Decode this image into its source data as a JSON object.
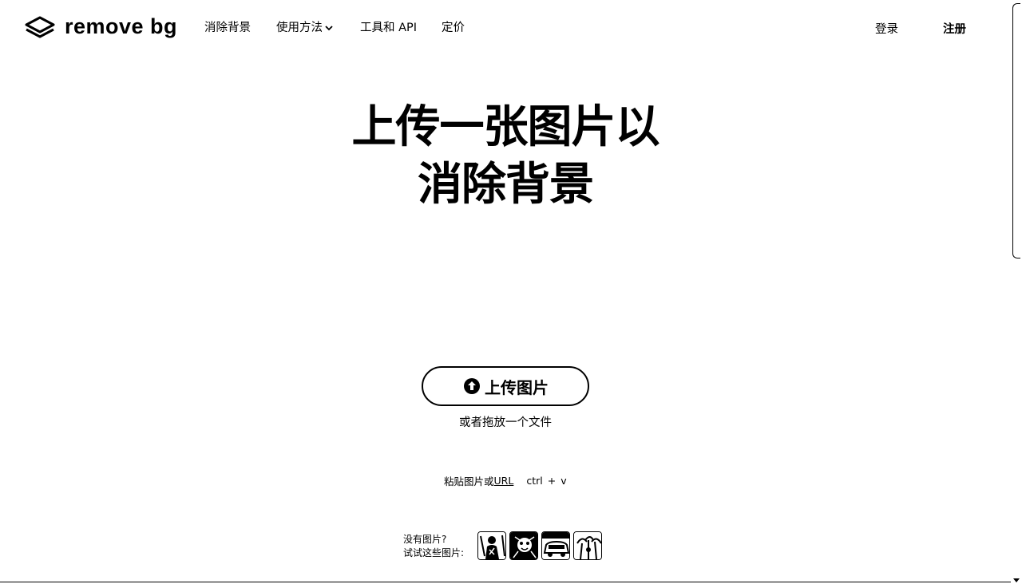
{
  "brand": {
    "name": "remove bg"
  },
  "nav": {
    "items": [
      {
        "label": "消除背景"
      },
      {
        "label": "使用方法"
      },
      {
        "label": "工具和 API"
      },
      {
        "label": "定价"
      }
    ],
    "login_label": "登录",
    "signup_label": "注册"
  },
  "hero": {
    "title_line1": "上传一张图片以",
    "title_line2": "消除背景"
  },
  "upload": {
    "button_label": "上传图片",
    "drop_text": "或者拖放一个文件"
  },
  "paste": {
    "prefix": "粘贴图片或 ",
    "url_label": "URL",
    "key1": "ctrl",
    "plus": "+",
    "key2": "v"
  },
  "samples": {
    "line1": "没有图片?",
    "line2": "试试这些图片:",
    "thumbs": [
      "person",
      "animal",
      "car",
      "object"
    ]
  },
  "icons": {
    "logo": "layers-logo-icon",
    "dropdown": "chevron-down-icon",
    "upload": "upload-icon"
  }
}
